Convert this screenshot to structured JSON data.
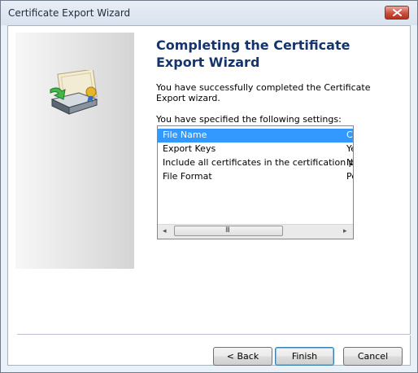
{
  "window": {
    "title": "Certificate Export Wizard"
  },
  "icons": {
    "close": "close-icon",
    "wizard": "certificate-export-icon"
  },
  "content": {
    "heading": "Completing the Certificate Export Wizard",
    "message": "You have successfully completed the Certificate Export wizard.",
    "settings_label": "You have specified the following settings:",
    "settings": [
      {
        "name": "File Name",
        "value": "C:\\User",
        "selected": true
      },
      {
        "name": "Export Keys",
        "value": "Yes",
        "selected": false
      },
      {
        "name": "Include all certificates in the certification path",
        "value": "No",
        "selected": false
      },
      {
        "name": "File Format",
        "value": "Persona",
        "selected": false
      }
    ],
    "scrollbar": {
      "left_arrow": "◂",
      "right_arrow": "▸",
      "grip": "III"
    }
  },
  "buttons": {
    "back": "< Back",
    "finish": "Finish",
    "cancel": "Cancel"
  },
  "colors": {
    "heading": "#15346b",
    "selection": "#3399ff"
  }
}
